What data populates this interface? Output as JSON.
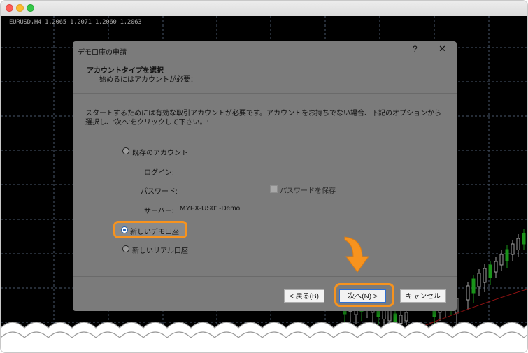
{
  "chart": {
    "symbol_label": "EURUSD,H4  1.2065 1.2071 1.2060 1.2063"
  },
  "dialog": {
    "title": "デモ口座の申請",
    "help": "?",
    "close": "✕",
    "header_title": "アカウントタイプを選択",
    "header_subtitle": "始めるにはアカウントが必要：",
    "description": "スタートするためには有効な取引アカウントが必要です。アカウントをお持ちでない場合、下記のオプションから選択し、'次へ'をクリックして下さい。:",
    "options": [
      {
        "label": "既存のアカウント",
        "checked": false
      },
      {
        "label": "新しいデモ口座",
        "checked": true
      },
      {
        "label": "新しいリアル口座",
        "checked": false
      }
    ],
    "login_label": "ログイン:",
    "password_label": "パスワード:",
    "server_label": "サーバー:",
    "server_value": "MYFX-US01-Demo",
    "save_password_label": "パスワードを保存",
    "buttons": {
      "back": "< 戻る(B)",
      "next": "次へ(N) >",
      "cancel": "キャンセル"
    }
  },
  "colors": {
    "highlight": "#f7931e",
    "dialog_bg": "#7b7b7b",
    "chart_bg": "#000000",
    "grid": "#6b7f9a"
  },
  "icons": [
    "close-icon",
    "help-icon",
    "down-arrow-icon"
  ]
}
